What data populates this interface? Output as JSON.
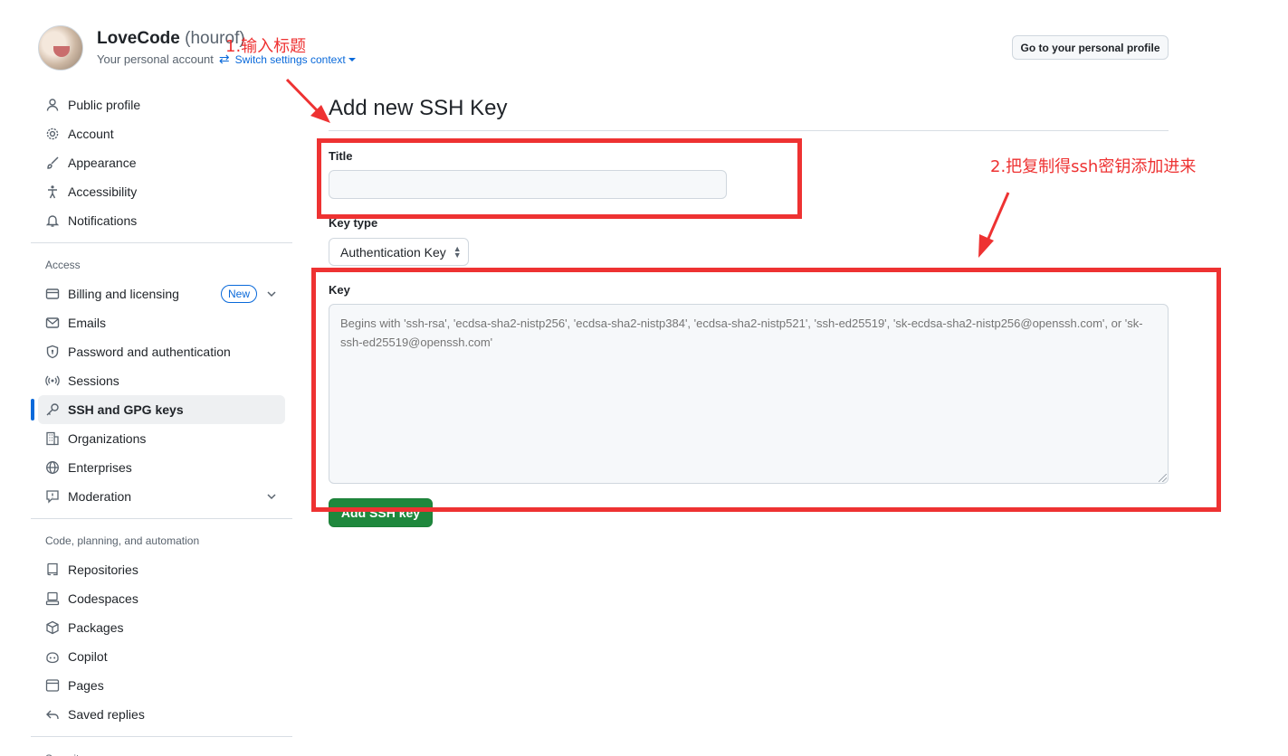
{
  "header": {
    "account_name": "LoveCode",
    "account_handle": "(hourof)",
    "account_sub": "Your personal account",
    "switch_context": "Switch settings context",
    "profile_button": "Go to your personal profile"
  },
  "sidebar": {
    "items_top": [
      {
        "label": "Public profile",
        "icon": "person-icon"
      },
      {
        "label": "Account",
        "icon": "gear-icon"
      },
      {
        "label": "Appearance",
        "icon": "paintbrush-icon"
      },
      {
        "label": "Accessibility",
        "icon": "accessibility-icon"
      },
      {
        "label": "Notifications",
        "icon": "bell-icon"
      }
    ],
    "access_title": "Access",
    "items_access": [
      {
        "label": "Billing and licensing",
        "icon": "credit-card-icon",
        "badge": "New"
      },
      {
        "label": "Emails",
        "icon": "mail-icon"
      },
      {
        "label": "Password and authentication",
        "icon": "shield-icon"
      },
      {
        "label": "Sessions",
        "icon": "broadcast-icon"
      },
      {
        "label": "SSH and GPG keys",
        "icon": "key-icon"
      },
      {
        "label": "Organizations",
        "icon": "organization-icon"
      },
      {
        "label": "Enterprises",
        "icon": "globe-icon"
      },
      {
        "label": "Moderation",
        "icon": "report-icon"
      }
    ],
    "code_title": "Code, planning, and automation",
    "items_code": [
      {
        "label": "Repositories",
        "icon": "repo-icon"
      },
      {
        "label": "Codespaces",
        "icon": "codespaces-icon"
      },
      {
        "label": "Packages",
        "icon": "package-icon"
      },
      {
        "label": "Copilot",
        "icon": "copilot-icon"
      },
      {
        "label": "Pages",
        "icon": "browser-icon"
      },
      {
        "label": "Saved replies",
        "icon": "reply-icon"
      }
    ],
    "security_title": "Security"
  },
  "main": {
    "page_title": "Add new SSH Key",
    "title_label": "Title",
    "title_value": "",
    "key_type_label": "Key type",
    "key_type_value": "Authentication Key",
    "key_label": "Key",
    "key_placeholder": "Begins with 'ssh-rsa', 'ecdsa-sha2-nistp256', 'ecdsa-sha2-nistp384', 'ecdsa-sha2-nistp521', 'ssh-ed25519', 'sk-ecdsa-sha2-nistp256@openssh.com', or 'sk-ssh-ed25519@openssh.com'",
    "submit_button": "Add SSH key"
  },
  "annotations": {
    "step1": "1.输入标题",
    "step2": "2.把复制得ssh密钥添加进来",
    "color": "#ee3232"
  },
  "colors": {
    "accent": "#0969da",
    "primary_button": "#1f883d"
  }
}
